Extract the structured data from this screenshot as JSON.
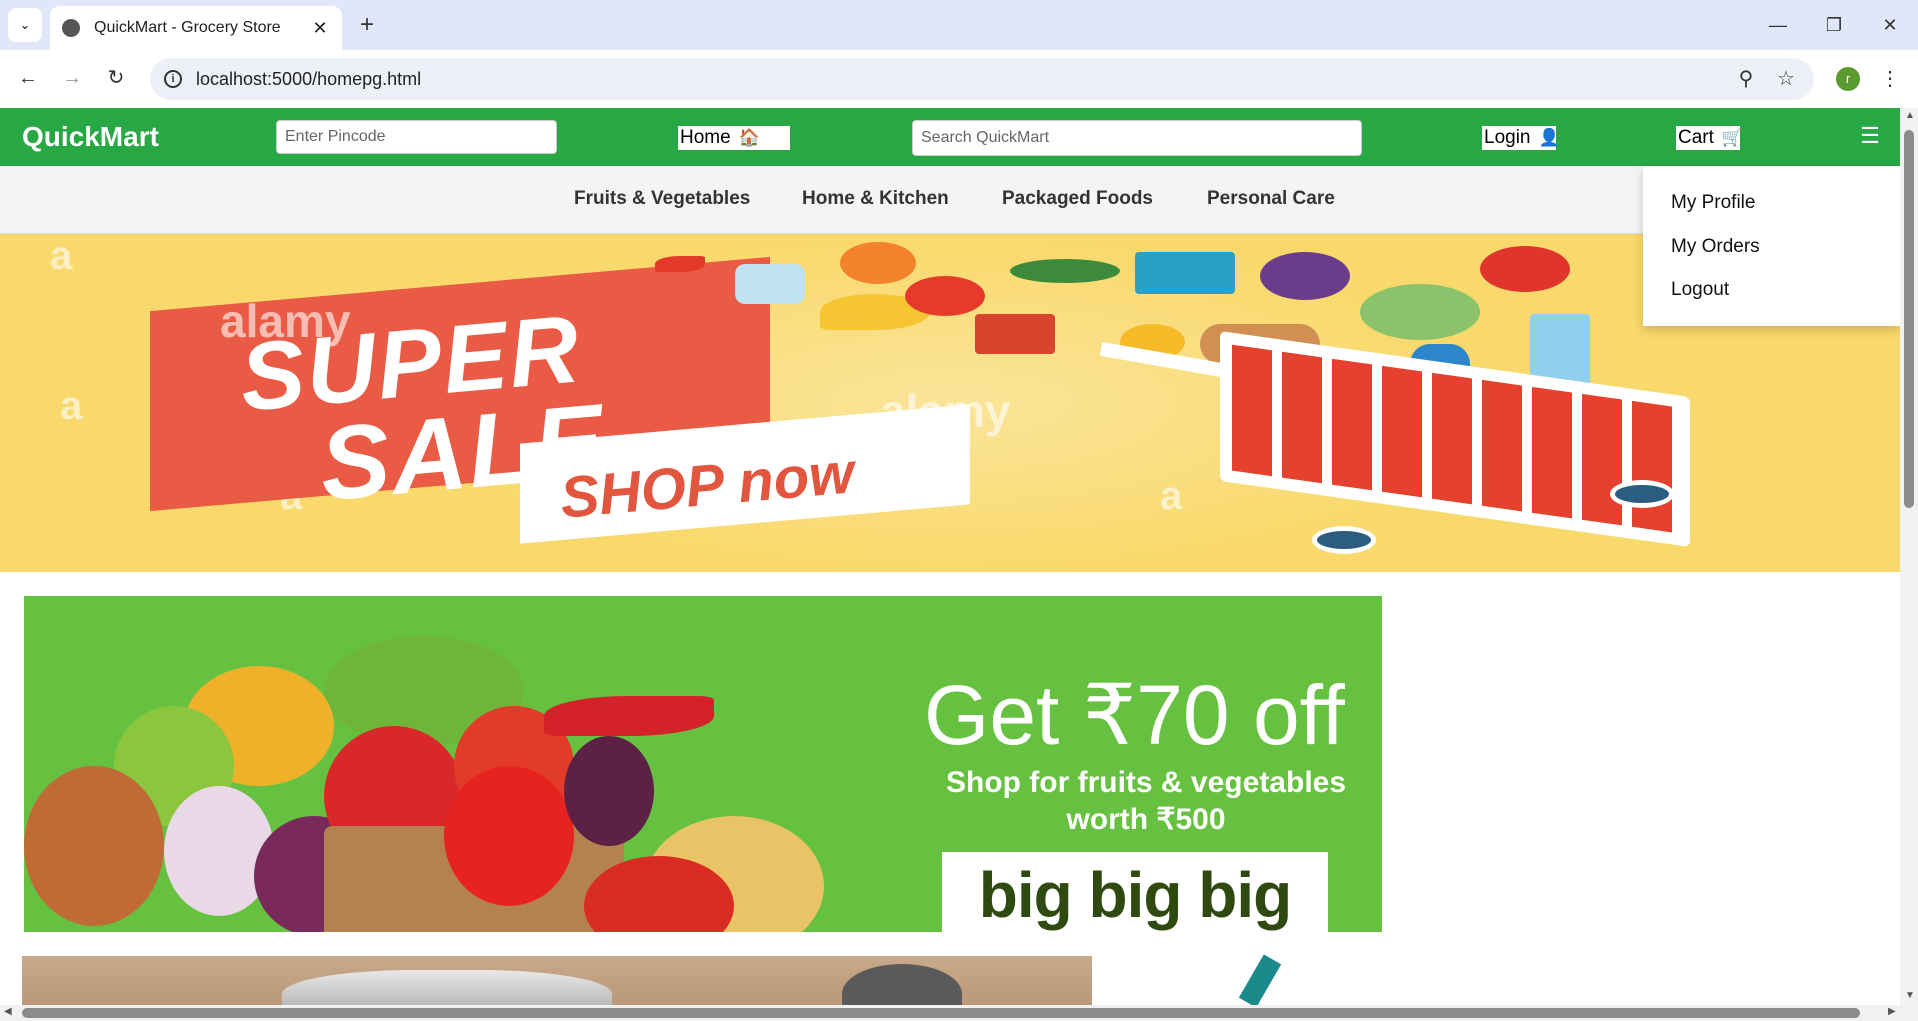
{
  "browser": {
    "tab_title": "QuickMart - Grocery Store",
    "tab_close": "✕",
    "new_tab": "+",
    "url": "localhost:5000/homepg.html",
    "profile_initial": "r",
    "window_controls": {
      "minimize": "—",
      "restore": "❐",
      "close": "✕"
    }
  },
  "header": {
    "logo": "QuickMart",
    "pincode_placeholder": "Enter Pincode",
    "home_label": "Home",
    "home_icon": "🏠",
    "search_placeholder": "Search QuickMart",
    "login_label": "Login",
    "login_icon": "👤",
    "cart_label": "Cart",
    "cart_icon": "🛒",
    "menu_icon": "☰"
  },
  "categories": [
    "Fruits & Vegetables",
    "Home & Kitchen",
    "Packaged Foods",
    "Personal Care"
  ],
  "dropdown": [
    "My Profile",
    "My Orders",
    "Logout"
  ],
  "hero": {
    "line1": "SUPER",
    "line2": "SALE",
    "cta": "SHOP now",
    "watermark": "alamy"
  },
  "promo": {
    "title": "Get ₹70 off",
    "sub1": "Shop for  fruits & vegetables",
    "sub2": "worth ₹500",
    "brand": "big big big"
  },
  "colors": {
    "header_green": "#28a745",
    "promo_green": "#67c140",
    "hero_yellow": "#f9d96b",
    "ribbon_red": "#ea5b45"
  }
}
